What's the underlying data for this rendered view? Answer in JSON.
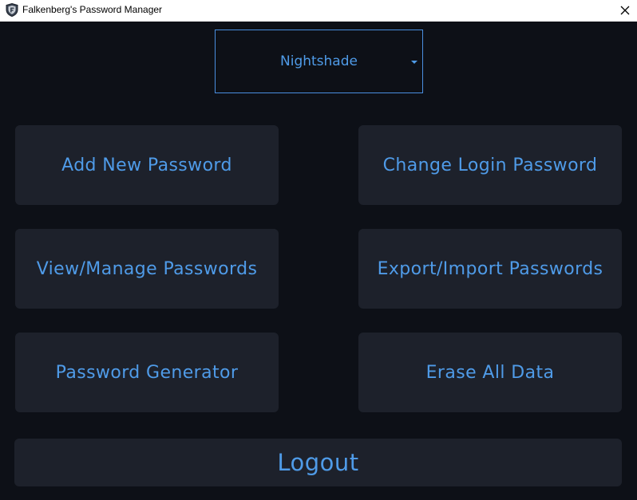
{
  "window": {
    "title": "Falkenberg's Password Manager",
    "icon": "shield-icon",
    "close_icon": "close-icon"
  },
  "theme_select": {
    "selected": "Nightshade"
  },
  "buttons": {
    "add_new_password": "Add New Password",
    "change_login_password": "Change Login Password",
    "view_manage_passwords": "View/Manage Passwords",
    "export_import_passwords": "Export/Import Passwords",
    "password_generator": "Password Generator",
    "erase_all_data": "Erase All Data",
    "logout": "Logout"
  },
  "colors": {
    "background": "#0d1017",
    "button_bg": "#1d212b",
    "accent": "#4f9be8"
  }
}
